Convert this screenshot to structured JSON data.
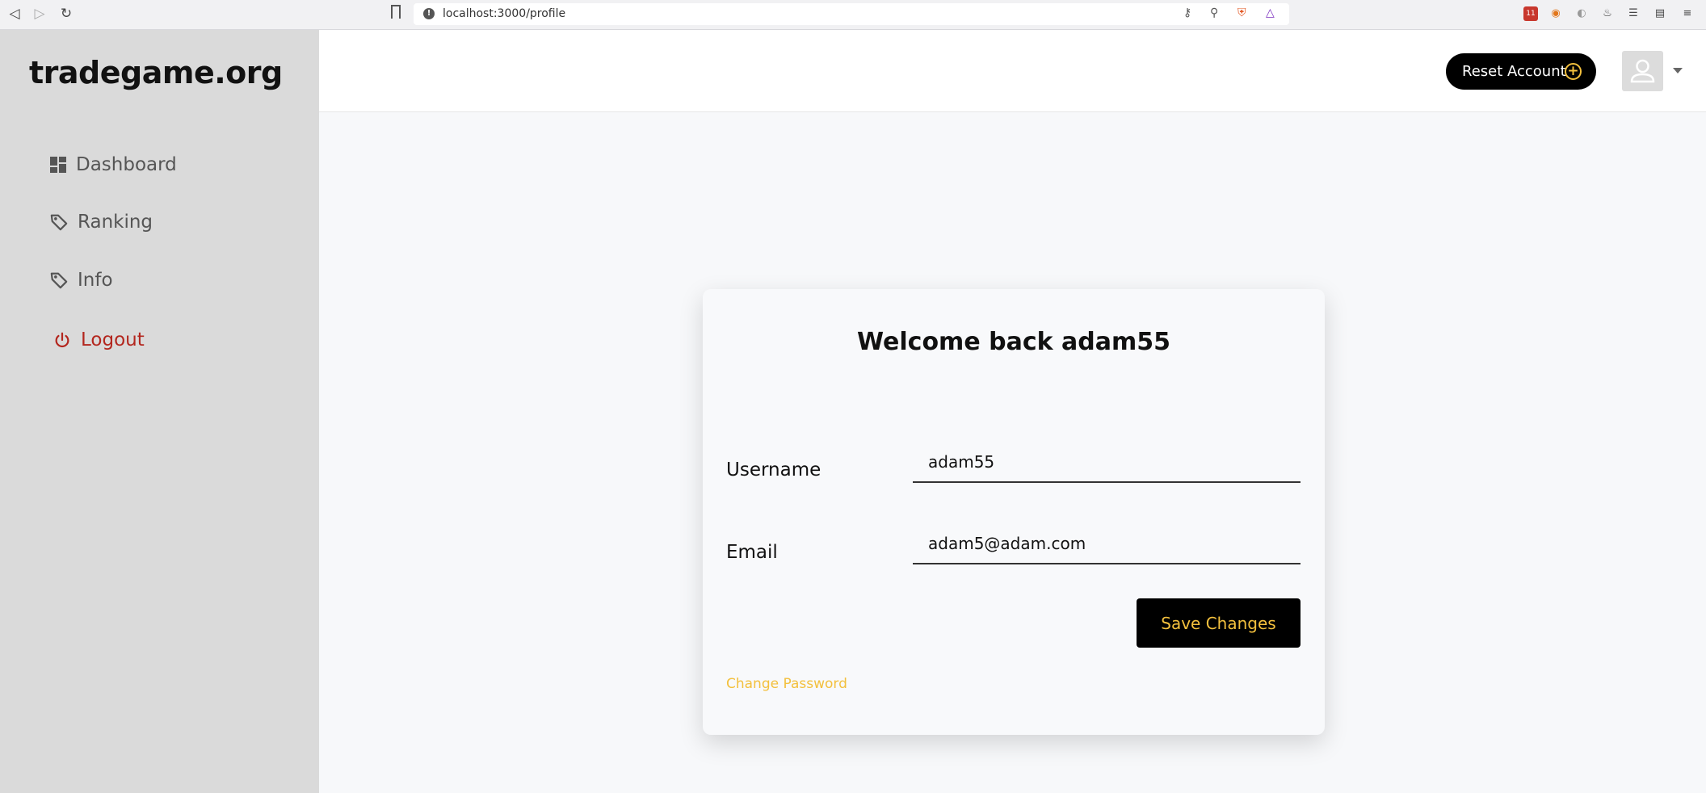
{
  "browser": {
    "url": "localhost:3000/profile",
    "ext_badge": "11"
  },
  "sidebar": {
    "brand": "tradegame.org",
    "items": [
      {
        "label": "Dashboard",
        "icon": "dashboard-icon"
      },
      {
        "label": "Ranking",
        "icon": "tag-icon"
      },
      {
        "label": "Info",
        "icon": "tag-icon"
      },
      {
        "label": "Logout",
        "icon": "power-icon"
      }
    ]
  },
  "header": {
    "reset_label": "Reset Account",
    "reset_icon": "plus-circle-icon",
    "avatar_icon": "user-icon"
  },
  "card": {
    "title": "Welcome back adam55",
    "username_label": "Username",
    "username_value": "adam55",
    "email_label": "Email",
    "email_value": "adam5@adam.com",
    "save_label": "Save Changes",
    "change_password_label": "Change Password"
  },
  "colors": {
    "accent": "#f3c03d",
    "logout": "#b3261e",
    "sidebar_bg": "#dadada"
  }
}
